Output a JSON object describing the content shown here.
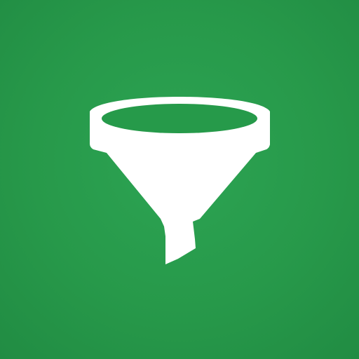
{
  "icon": {
    "name": "funnel-icon",
    "foreground": "#ffffff",
    "background": "#269a4a"
  }
}
